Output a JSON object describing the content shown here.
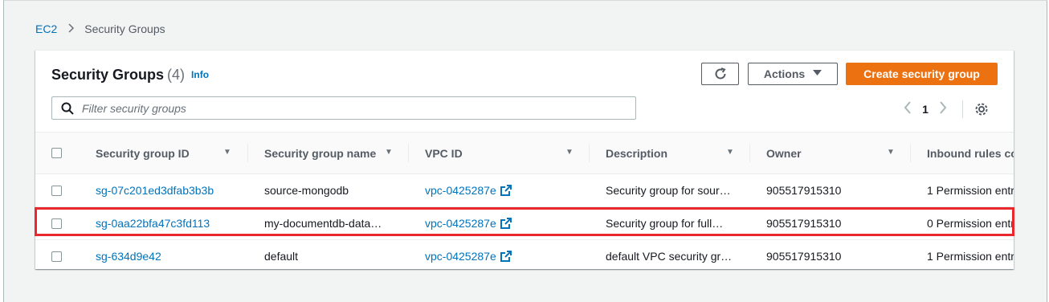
{
  "breadcrumb": {
    "root": "EC2",
    "current": "Security Groups"
  },
  "header": {
    "title": "Security Groups",
    "count": "(4)",
    "info": "Info"
  },
  "toolbar": {
    "actions_label": "Actions",
    "create_label": "Create security group"
  },
  "search": {
    "placeholder": "Filter security groups",
    "value": ""
  },
  "pagination": {
    "current_page": "1"
  },
  "columns": [
    "Security group ID",
    "Security group name",
    "VPC ID",
    "Description",
    "Owner",
    "Inbound rules co"
  ],
  "rows": [
    {
      "id": "sg-07c201ed3dfab3b3b",
      "name": "source-mongodb",
      "vpc": "vpc-0425287e",
      "description": "Security group for sour…",
      "owner": "905517915310",
      "inbound": "1 Permission entr"
    },
    {
      "id": "sg-0aa22bfa47c3fd113",
      "name": "my-documentdb-data…",
      "vpc": "vpc-0425287e",
      "description": "Security group for full…",
      "owner": "905517915310",
      "inbound": "0 Permission entr"
    },
    {
      "id": "sg-634d9e42",
      "name": "default",
      "vpc": "vpc-0425287e",
      "description": "default VPC security gr…",
      "owner": "905517915310",
      "inbound": "1 Permission entr"
    }
  ],
  "highlighted_row_index": 1,
  "colors": {
    "link": "#0073bb",
    "primary_button": "#ec7211",
    "highlight_border": "#e8282d"
  }
}
